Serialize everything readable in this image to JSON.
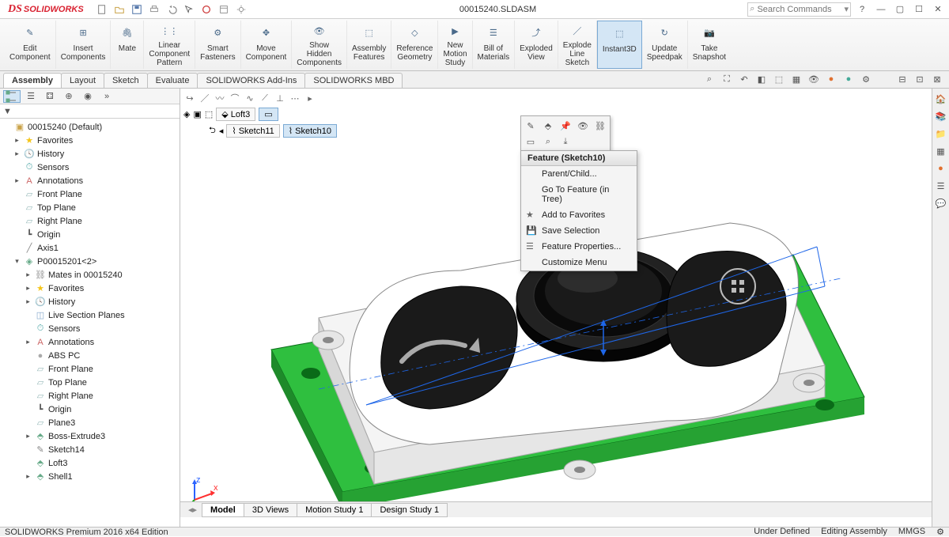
{
  "app": {
    "logo": "SOLIDWORKS",
    "title": "00015240.SLDASM",
    "status": "SOLIDWORKS Premium 2016 x64 Edition",
    "search_placeholder": "Search Commands"
  },
  "ribbon": [
    {
      "label": "Edit\nComponent",
      "name": "edit-component"
    },
    {
      "label": "Insert\nComponents",
      "name": "insert-components"
    },
    {
      "label": "Mate",
      "name": "mate"
    },
    {
      "label": "Linear\nComponent\nPattern",
      "name": "linear-pattern"
    },
    {
      "label": "Smart\nFasteners",
      "name": "smart-fasteners"
    },
    {
      "label": "Move\nComponent",
      "name": "move-component"
    },
    {
      "label": "Show\nHidden\nComponents",
      "name": "show-hidden"
    },
    {
      "label": "Assembly\nFeatures",
      "name": "assembly-features"
    },
    {
      "label": "Reference\nGeometry",
      "name": "reference-geometry"
    },
    {
      "label": "New\nMotion\nStudy",
      "name": "new-motion"
    },
    {
      "label": "Bill of\nMaterials",
      "name": "bom"
    },
    {
      "label": "Exploded\nView",
      "name": "exploded-view"
    },
    {
      "label": "Explode\nLine\nSketch",
      "name": "explode-line"
    },
    {
      "label": "Instant3D",
      "name": "instant3d",
      "active": true
    },
    {
      "label": "Update\nSpeedpak",
      "name": "update-speedpak"
    },
    {
      "label": "Take\nSnapshot",
      "name": "snapshot"
    }
  ],
  "cmd_tabs": [
    "Assembly",
    "Layout",
    "Sketch",
    "Evaluate",
    "SOLIDWORKS Add-Ins",
    "SOLIDWORKS MBD"
  ],
  "cmd_active": 0,
  "tree": [
    {
      "d": 0,
      "exp": "",
      "icon": "asm",
      "label": "00015240  (Default)"
    },
    {
      "d": 1,
      "exp": "▸",
      "icon": "fav",
      "label": "Favorites"
    },
    {
      "d": 1,
      "exp": "▸",
      "icon": "hist",
      "label": "History"
    },
    {
      "d": 1,
      "exp": "",
      "icon": "sens",
      "label": "Sensors"
    },
    {
      "d": 1,
      "exp": "▸",
      "icon": "anno",
      "label": "Annotations"
    },
    {
      "d": 1,
      "exp": "",
      "icon": "plane",
      "label": "Front Plane"
    },
    {
      "d": 1,
      "exp": "",
      "icon": "plane",
      "label": "Top Plane"
    },
    {
      "d": 1,
      "exp": "",
      "icon": "plane",
      "label": "Right Plane"
    },
    {
      "d": 1,
      "exp": "",
      "icon": "origin",
      "label": "Origin"
    },
    {
      "d": 1,
      "exp": "",
      "icon": "axis",
      "label": "Axis1"
    },
    {
      "d": 1,
      "exp": "▾",
      "icon": "part",
      "label": "P00015201<2>"
    },
    {
      "d": 2,
      "exp": "▸",
      "icon": "mates",
      "label": "Mates in 00015240"
    },
    {
      "d": 2,
      "exp": "▸",
      "icon": "fav",
      "label": "Favorites"
    },
    {
      "d": 2,
      "exp": "▸",
      "icon": "hist",
      "label": "History"
    },
    {
      "d": 2,
      "exp": "",
      "icon": "sect",
      "label": "Live Section Planes"
    },
    {
      "d": 2,
      "exp": "",
      "icon": "sens",
      "label": "Sensors"
    },
    {
      "d": 2,
      "exp": "▸",
      "icon": "anno",
      "label": "Annotations"
    },
    {
      "d": 2,
      "exp": "",
      "icon": "mat",
      "label": "ABS PC"
    },
    {
      "d": 2,
      "exp": "",
      "icon": "plane",
      "label": "Front Plane"
    },
    {
      "d": 2,
      "exp": "",
      "icon": "plane",
      "label": "Top Plane"
    },
    {
      "d": 2,
      "exp": "",
      "icon": "plane",
      "label": "Right Plane"
    },
    {
      "d": 2,
      "exp": "",
      "icon": "origin",
      "label": "Origin"
    },
    {
      "d": 2,
      "exp": "",
      "icon": "plane",
      "label": "Plane3"
    },
    {
      "d": 2,
      "exp": "▸",
      "icon": "feat",
      "label": "Boss-Extrude3"
    },
    {
      "d": 2,
      "exp": "",
      "icon": "sketch",
      "label": "Sketch14"
    },
    {
      "d": 2,
      "exp": "",
      "icon": "feat",
      "label": "Loft3"
    },
    {
      "d": 2,
      "exp": "▸",
      "icon": "feat",
      "label": "Shell1"
    }
  ],
  "breadcrumb": {
    "loft": "Loft3",
    "sk11": "Sketch11",
    "sk10": "Sketch10"
  },
  "context": {
    "header": "Feature (Sketch10)",
    "items": [
      {
        "label": "Parent/Child...",
        "icon": ""
      },
      {
        "label": "Go To Feature (in Tree)",
        "icon": ""
      },
      {
        "label": "Add to Favorites",
        "icon": "star"
      },
      {
        "label": "Save Selection",
        "icon": "save"
      },
      {
        "label": "Feature Properties...",
        "icon": "props"
      },
      {
        "label": "Customize Menu",
        "icon": ""
      }
    ]
  },
  "bottom_tabs": [
    "Model",
    "3D Views",
    "Motion Study 1",
    "Design Study 1"
  ],
  "bottom_active": 0,
  "status_right": [
    "Under Defined",
    "Editing Assembly",
    "MMGS"
  ]
}
